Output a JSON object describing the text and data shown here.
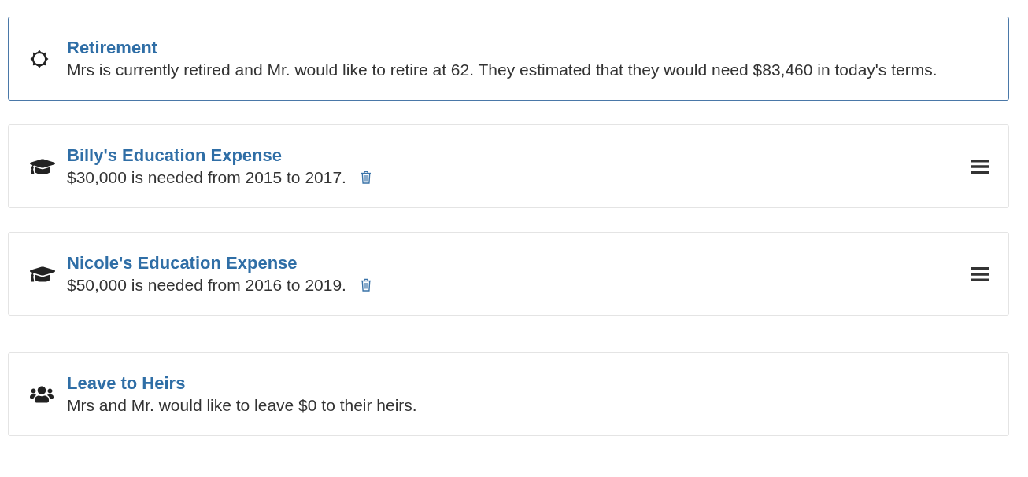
{
  "sections": [
    {
      "goals": [
        {
          "kind": "retirement",
          "selected": true,
          "title": "Retirement",
          "description": "Mrs is currently retired and Mr. would like to retire at 62. They estimated that they would need $83,460 in today's terms.",
          "deletable": false,
          "reorderable": false
        },
        {
          "kind": "education",
          "selected": false,
          "title": "Billy's Education Expense",
          "description": "$30,000 is needed from 2015 to 2017.",
          "deletable": true,
          "reorderable": true
        },
        {
          "kind": "education",
          "selected": false,
          "title": "Nicole's Education Expense",
          "description": "$50,000 is needed from 2016 to 2019.",
          "deletable": true,
          "reorderable": true
        }
      ]
    },
    {
      "goals": [
        {
          "kind": "heirs",
          "selected": false,
          "title": "Leave to Heirs",
          "description": "Mrs and Mr. would like to leave $0 to their heirs.",
          "deletable": false,
          "reorderable": false
        }
      ]
    }
  ]
}
